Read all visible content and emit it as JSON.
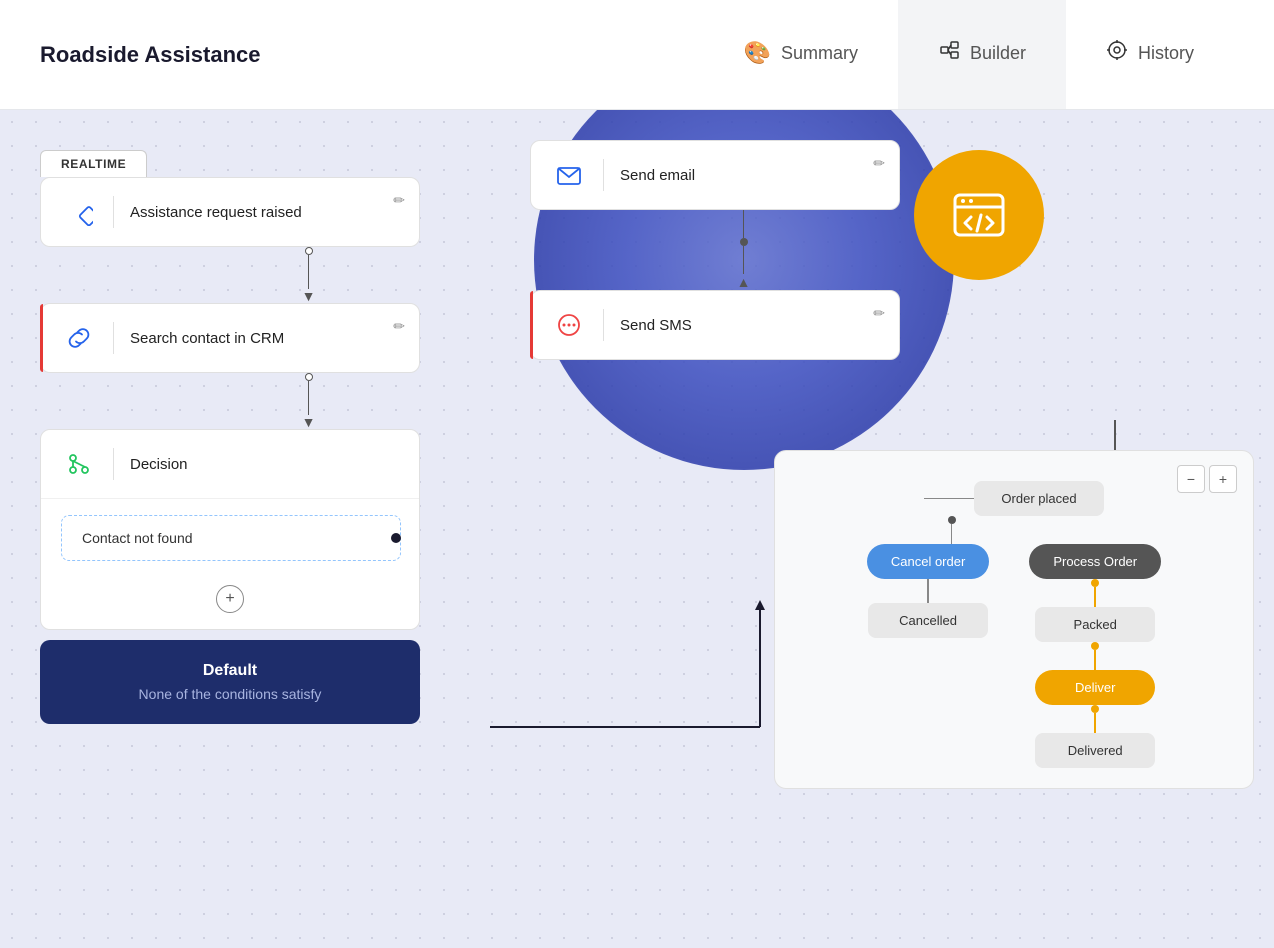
{
  "header": {
    "title": "Roadside Assistance",
    "tabs": [
      {
        "id": "summary",
        "label": "Summary",
        "icon": "🎨",
        "active": false
      },
      {
        "id": "builder",
        "label": "Builder",
        "icon": "🖧",
        "active": true
      },
      {
        "id": "history",
        "label": "History",
        "icon": "⚙️",
        "active": false
      }
    ]
  },
  "workflow": {
    "realtime_badge": "REALTIME",
    "card1": {
      "label": "Assistance request raised",
      "edit_icon": "✏"
    },
    "card2": {
      "label": "Search contact in CRM",
      "edit_icon": "✏"
    },
    "decision": {
      "label": "Decision",
      "condition": "Contact not found",
      "plus_label": "+",
      "default_title": "Default",
      "default_subtitle": "None of the conditions satisfy"
    }
  },
  "right_cards": {
    "send_email": {
      "label": "Send email",
      "edit_icon": "✏"
    },
    "send_sms": {
      "label": "Send SMS",
      "edit_icon": "✏"
    }
  },
  "mini_flowchart": {
    "controls": {
      "minus": "−",
      "plus": "+"
    },
    "nodes": {
      "order_placed": "Order placed",
      "cancel_order": "Cancel order",
      "process_order": "Process Order",
      "cancelled": "Cancelled",
      "packed": "Packed",
      "deliver": "Deliver",
      "delivered": "Delivered"
    }
  }
}
